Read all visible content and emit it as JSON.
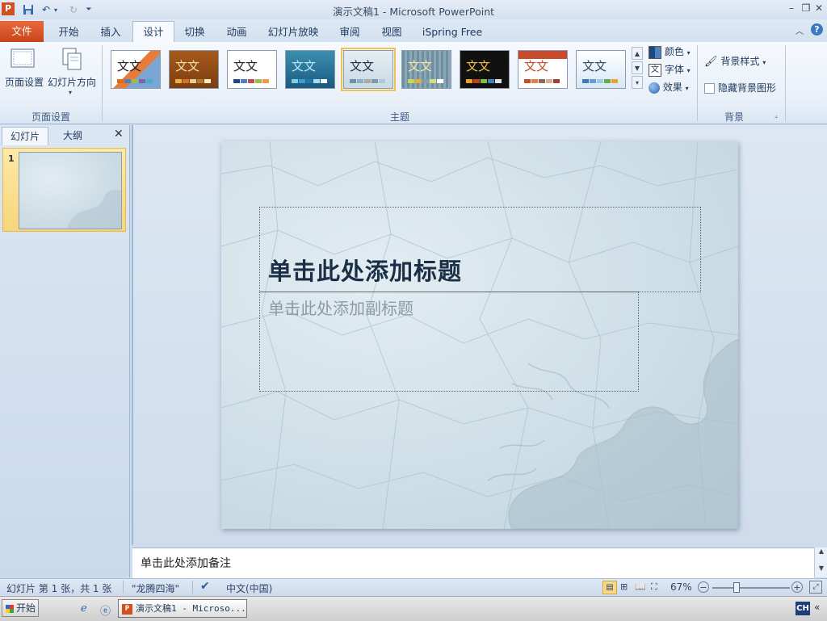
{
  "window": {
    "title": "演示文稿1 - Microsoft PowerPoint",
    "app_icon": "P"
  },
  "tabs": [
    {
      "label": "文件"
    },
    {
      "label": "开始"
    },
    {
      "label": "插入"
    },
    {
      "label": "设计"
    },
    {
      "label": "切换"
    },
    {
      "label": "动画"
    },
    {
      "label": "幻灯片放映"
    },
    {
      "label": "审阅"
    },
    {
      "label": "视图"
    },
    {
      "label": "iSpring Free"
    }
  ],
  "ribbon": {
    "page_setup": {
      "btn_page_setup": "页面设置",
      "btn_orientation": "幻灯片方向",
      "group": "页面设置"
    },
    "themes": {
      "group": "主题",
      "sample_text": "文文"
    },
    "theme_menu": {
      "colors": "颜色",
      "fonts": "字体",
      "effects": "效果"
    },
    "background": {
      "styles": "背景样式",
      "hide_graphics": "隐藏背景图形",
      "group": "背景"
    }
  },
  "left_pane": {
    "tab_slides": "幻灯片",
    "tab_outline": "大纲",
    "slide_number": "1"
  },
  "slide": {
    "title_placeholder": "单击此处添加标题",
    "subtitle_placeholder": "单击此处添加副标题"
  },
  "notes": {
    "placeholder": "单击此处添加备注"
  },
  "status": {
    "slide_info": "幻灯片 第 1 张，共 1 张",
    "theme_name": "\"龙腾四海\"",
    "language": "中文(中国)",
    "zoom": "67%"
  },
  "taskbar": {
    "start": "开始",
    "task_item": "演示文稿1 - Microso...",
    "ime": "CH"
  },
  "colors": {
    "accent_file_tab": "#d2501f",
    "ribbon_bg": "#e9f0f8",
    "selected_theme": "#f0c34a"
  }
}
